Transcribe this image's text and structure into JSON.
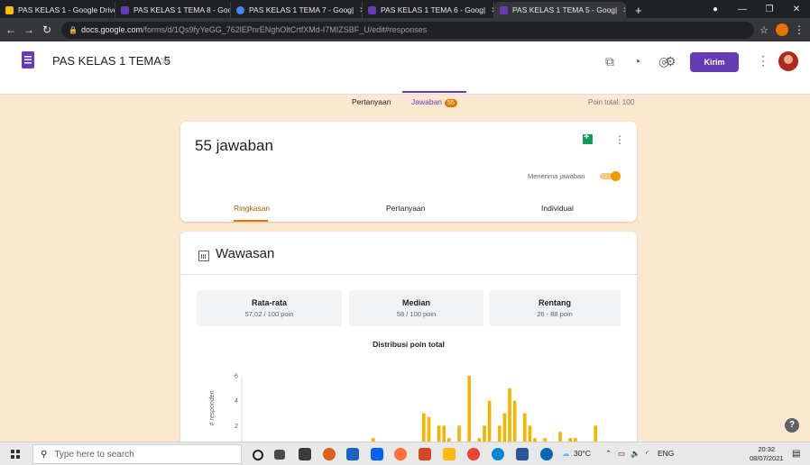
{
  "browser": {
    "tabs": [
      {
        "title": "PAS KELAS 1 - Google Drive",
        "color": "#fbbc04"
      },
      {
        "title": "PAS KELAS 1 TEMA 8 - Goog|",
        "color": "#673ab7"
      },
      {
        "title": "PAS KELAS 1 TEMA 7 - Goog|",
        "color": "#4285f4"
      },
      {
        "title": "PAS KELAS 1 TEMA 6 - Goog|",
        "color": "#673ab7"
      },
      {
        "title": "PAS KELAS 1 TEMA 5 - Goog|",
        "color": "#673ab7"
      }
    ],
    "active_tab": 4,
    "url_host": "docs.google.com",
    "url_path": "/forms/d/1Qs9fyYeGG_762lEPnrENghOltCrtfXMd-I7MIZSBF_U/edit#responses"
  },
  "form": {
    "title": "PAS KELAS 1 TEMA 5",
    "send_label": "Kirim",
    "tabs": {
      "questions": "Pertanyaan",
      "responses": "Jawaban",
      "responses_count": "55"
    },
    "total_points": "Poin total: 100"
  },
  "responses": {
    "count_label": "55 jawaban",
    "accepting_label": "Menerima jawaban",
    "accepting": true,
    "subtabs": {
      "summary": "Ringkasan",
      "question": "Pertanyaan",
      "individual": "Individual"
    }
  },
  "insights": {
    "title": "Wawasan",
    "stats": [
      {
        "label": "Rata-rata",
        "value": "57,02 / 100 poin"
      },
      {
        "label": "Median",
        "value": "58 / 100 poin"
      },
      {
        "label": "Rentang",
        "value": "26 - 88 poin"
      }
    ]
  },
  "chart_data": {
    "type": "bar",
    "title": "Distribusi poin total",
    "ylabel": "# responden",
    "ylim": [
      0,
      6
    ],
    "yticks": [
      "2",
      "4",
      "6"
    ],
    "bar_color": "#f4b400",
    "series": [
      {
        "values": [
          0.5,
          0,
          0,
          0,
          0,
          0,
          0,
          0,
          0,
          0,
          0,
          0,
          0,
          0,
          0,
          0,
          0,
          0,
          0,
          0,
          0,
          0,
          0,
          0,
          0,
          1,
          0,
          0,
          0,
          0,
          0,
          0,
          0,
          0,
          0,
          3,
          2.7,
          0,
          2,
          2,
          1,
          0,
          2,
          0,
          6,
          0,
          1,
          2,
          4,
          0,
          2,
          3,
          5,
          4,
          0,
          3,
          2,
          1,
          0,
          1,
          0,
          0,
          1.5,
          0,
          1,
          1,
          0,
          0,
          0,
          2
        ]
      }
    ]
  },
  "help_label": "?",
  "taskbar": {
    "search_placeholder": "Type here to search",
    "weather": "30°C",
    "lang": "ENG",
    "time": "20:32",
    "date": "08/07/2021"
  }
}
